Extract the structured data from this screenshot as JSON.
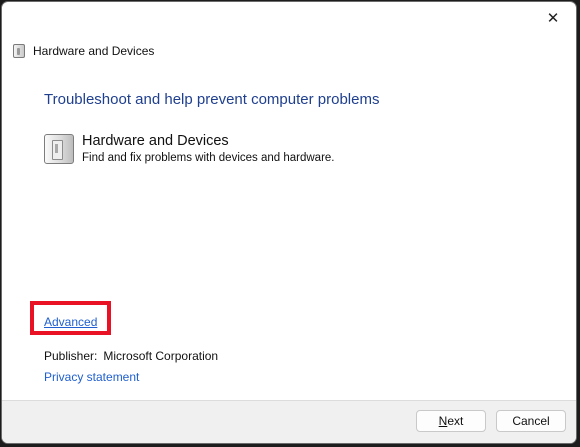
{
  "window": {
    "title": "Hardware and Devices",
    "close_glyph": "✕"
  },
  "main": {
    "heading": "Troubleshoot and help prevent computer problems",
    "item": {
      "title": "Hardware and Devices",
      "description": "Find and fix problems with devices and hardware.",
      "icon": "hardware-icon"
    },
    "advanced_link": "Advanced",
    "publisher_label": "Publisher:",
    "publisher_value": "Microsoft Corporation",
    "privacy_link": "Privacy statement"
  },
  "footer": {
    "next_accesskey": "N",
    "next_rest": "ext",
    "cancel_label": "Cancel"
  },
  "colors": {
    "heading": "#1f3f8f",
    "link": "#1f5fcf",
    "highlight": "#e81224"
  }
}
